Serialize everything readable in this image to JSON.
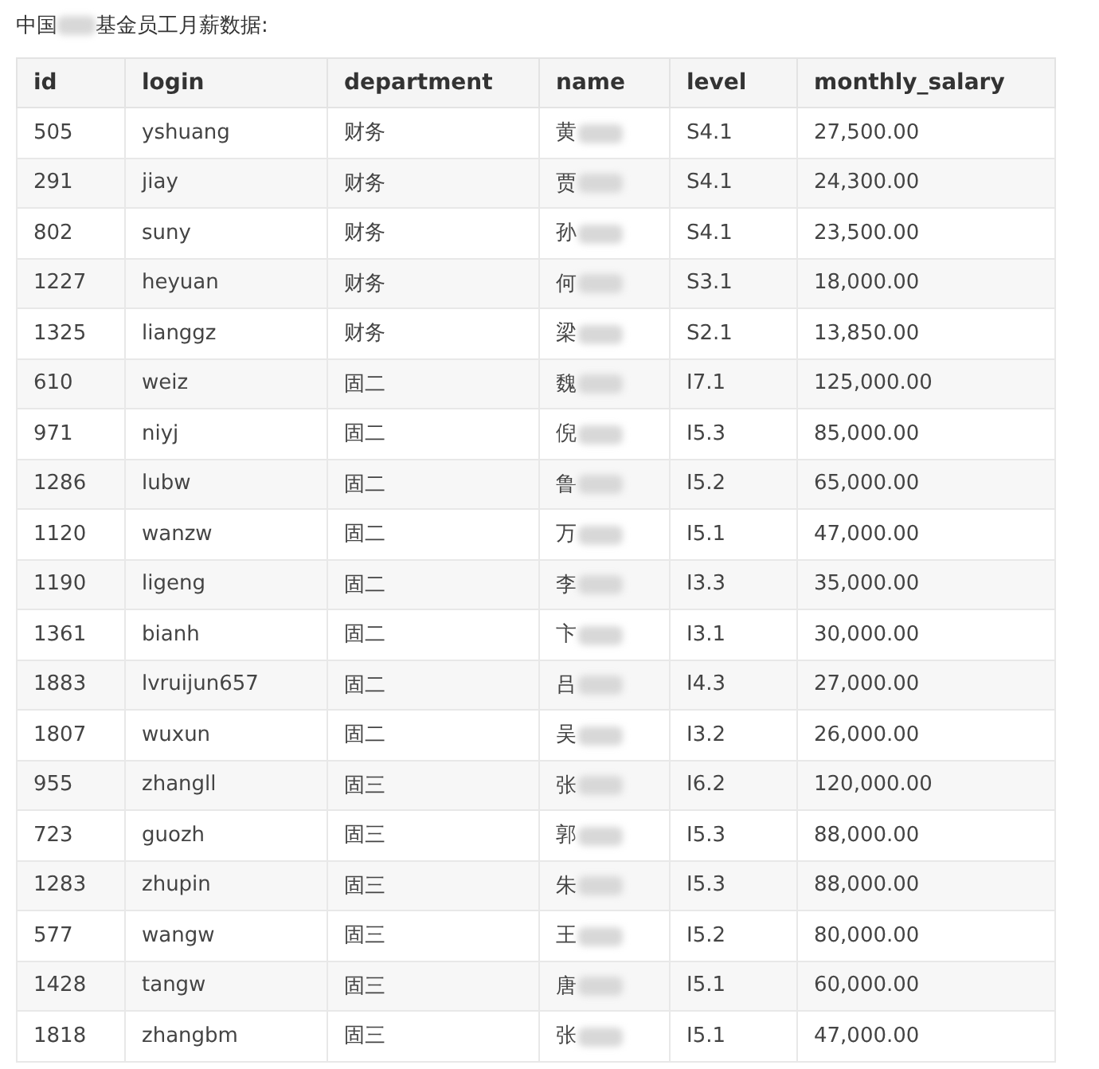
{
  "title": {
    "before": "中国",
    "after": "基金员工月薪数据:"
  },
  "table": {
    "columns": [
      "id",
      "login",
      "department",
      "name",
      "level",
      "monthly_salary"
    ],
    "rows": [
      [
        "505",
        "yshuang",
        "财务",
        "黄",
        "S4.1",
        "27,500.00"
      ],
      [
        "291",
        "jiay",
        "财务",
        "贾",
        "S4.1",
        "24,300.00"
      ],
      [
        "802",
        "suny",
        "财务",
        "孙",
        "S4.1",
        "23,500.00"
      ],
      [
        "1227",
        "heyuan",
        "财务",
        "何",
        "S3.1",
        "18,000.00"
      ],
      [
        "1325",
        "lianggz",
        "财务",
        "梁",
        "S2.1",
        "13,850.00"
      ],
      [
        "610",
        "weiz",
        "固二",
        "魏",
        "I7.1",
        "125,000.00"
      ],
      [
        "971",
        "niyj",
        "固二",
        "倪",
        "I5.3",
        "85,000.00"
      ],
      [
        "1286",
        "lubw",
        "固二",
        "鲁",
        "I5.2",
        "65,000.00"
      ],
      [
        "1120",
        "wanzw",
        "固二",
        "万",
        "I5.1",
        "47,000.00"
      ],
      [
        "1190",
        "ligeng",
        "固二",
        "李",
        "I3.3",
        "35,000.00"
      ],
      [
        "1361",
        "bianh",
        "固二",
        "卞",
        "I3.1",
        "30,000.00"
      ],
      [
        "1883",
        "lvruijun657",
        "固二",
        "吕",
        "I4.3",
        "27,000.00"
      ],
      [
        "1807",
        "wuxun",
        "固二",
        "吴",
        "I3.2",
        "26,000.00"
      ],
      [
        "955",
        "zhangll",
        "固三",
        "张",
        "I6.2",
        "120,000.00"
      ],
      [
        "723",
        "guozh",
        "固三",
        "郭",
        "I5.3",
        "88,000.00"
      ],
      [
        "1283",
        "zhupin",
        "固三",
        "朱",
        "I5.3",
        "88,000.00"
      ],
      [
        "577",
        "wangw",
        "固三",
        "王",
        "I5.2",
        "80,000.00"
      ],
      [
        "1428",
        "tangw",
        "固三",
        "唐",
        "I5.1",
        "60,000.00"
      ],
      [
        "1818",
        "zhangbm",
        "固三",
        "张",
        "I5.1",
        "47,000.00"
      ]
    ]
  }
}
